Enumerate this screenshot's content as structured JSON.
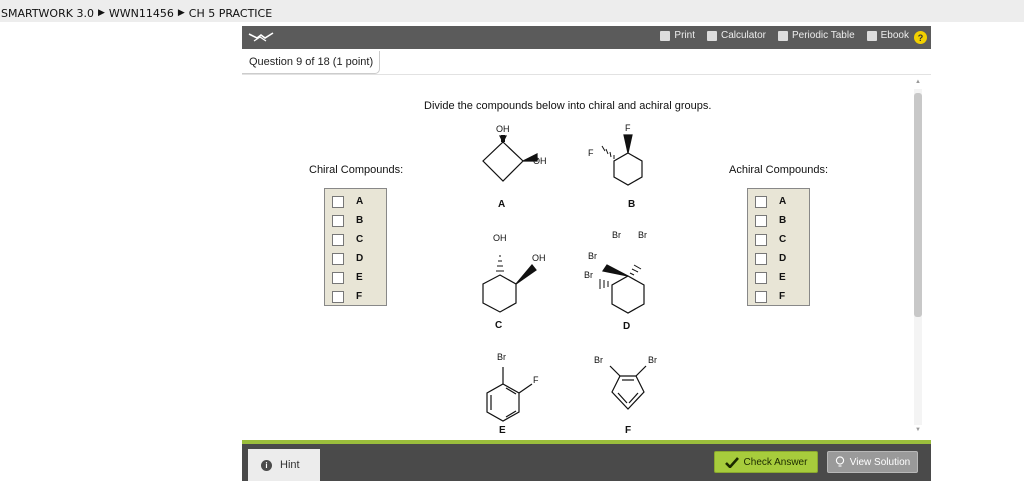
{
  "breadcrumb": [
    "SMARTWORK 3.0",
    "WWN11456",
    "CH 5 PRACTICE"
  ],
  "toolbar": {
    "print": "Print",
    "calculator": "Calculator",
    "periodic_table": "Periodic Table",
    "ebook": "Ebook",
    "help": "?"
  },
  "question_tab": "Question 9 of 18 (1 point)",
  "prompt": "Divide the compounds below into chiral and achiral groups.",
  "chiral_label": "Chiral Compounds:",
  "achiral_label": "Achiral Compounds:",
  "options": [
    "A",
    "B",
    "C",
    "D",
    "E",
    "F"
  ],
  "molecules": {
    "A": {
      "label": "A",
      "oh_top": "OH",
      "oh_side": "OH"
    },
    "B": {
      "label": "B",
      "f_top": "F",
      "f_side": "F"
    },
    "C": {
      "label": "C",
      "oh_top": "OH",
      "oh_side": "OH"
    },
    "D": {
      "label": "D",
      "br1": "Br",
      "br2": "Br",
      "br3": "Br",
      "br4": "Br"
    },
    "E": {
      "label": "E",
      "br": "Br",
      "f": "F"
    },
    "F": {
      "label": "F",
      "br1": "Br",
      "br2": "Br"
    }
  },
  "footer": {
    "hint": "Hint",
    "check_answer": "Check Answer",
    "view_solution": "View Solution"
  },
  "colors": {
    "topbar": "#5b5b5b",
    "accent_green": "#a7cc3c",
    "answer_box": "#e8e5d6",
    "help_yellow": "#f2d000"
  }
}
